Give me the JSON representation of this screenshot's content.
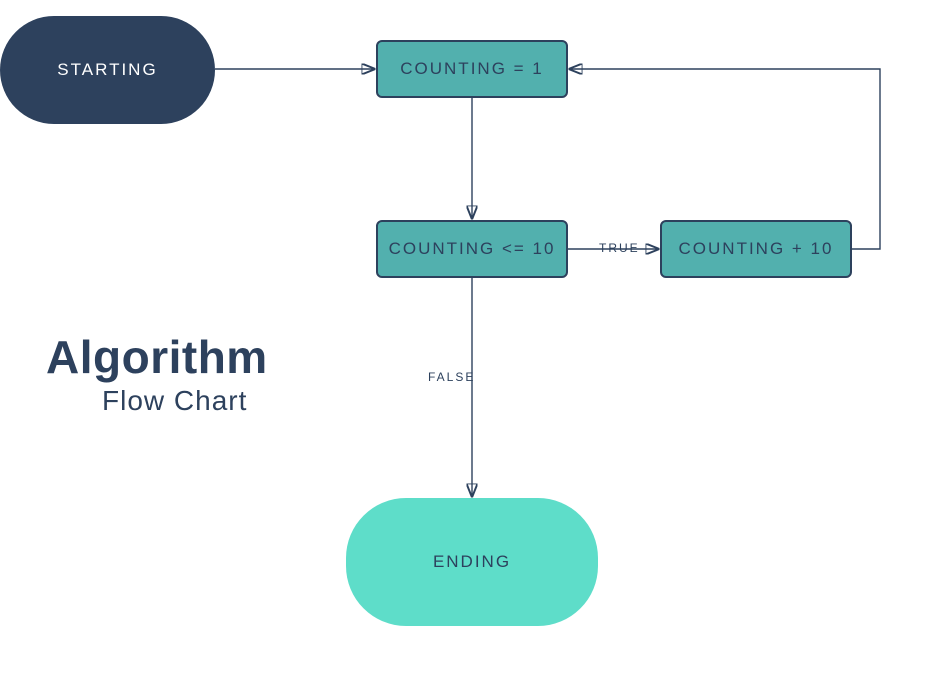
{
  "title": {
    "main": "Algorithm",
    "sub": "Flow Chart"
  },
  "nodes": {
    "start": "STARTING",
    "init": "COUNTING = 1",
    "cond": "COUNTING <= 10",
    "inc": "COUNTING + 10",
    "end": "ENDING"
  },
  "edges": {
    "true": "TRUE",
    "false": "FALSE"
  },
  "colors": {
    "dark": "#2d415d",
    "teal": "#52b0ae",
    "mint": "#5eddc9"
  }
}
